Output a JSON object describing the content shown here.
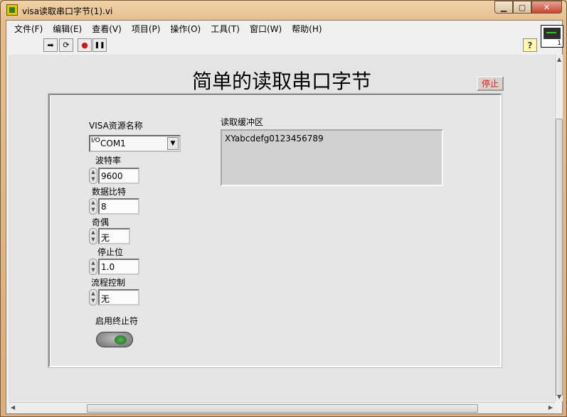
{
  "window": {
    "title": "visa读取串口字节(1).vi",
    "min": "▁",
    "max": "▢",
    "close": "✕"
  },
  "menu": [
    "文件(F)",
    "编辑(E)",
    "查看(V)",
    "项目(P)",
    "操作(O)",
    "工具(T)",
    "窗口(W)",
    "帮助(H)"
  ],
  "toolbar": {
    "run": "➡",
    "run_continuous": "⟳",
    "abort": "●",
    "pause": "❚❚",
    "help": "?"
  },
  "vi_icon_number": "1",
  "panel": {
    "title": "简单的读取串口字节",
    "stop_label": "停止",
    "visa_label": "VISA资源名称",
    "visa_io": "I/O",
    "visa_value": "COM1",
    "baud_label": "波特率",
    "baud_value": "9600",
    "databits_label": "数据比特",
    "databits_value": "8",
    "parity_label": "奇偶",
    "parity_value": "无",
    "stopbits_label": "停止位",
    "stopbits_value": "1.0",
    "flow_label": "流程控制",
    "flow_value": "无",
    "term_label": "启用终止符",
    "buffer_label": "读取缓冲区",
    "buffer_value": "XYabcdefg0123456789"
  }
}
